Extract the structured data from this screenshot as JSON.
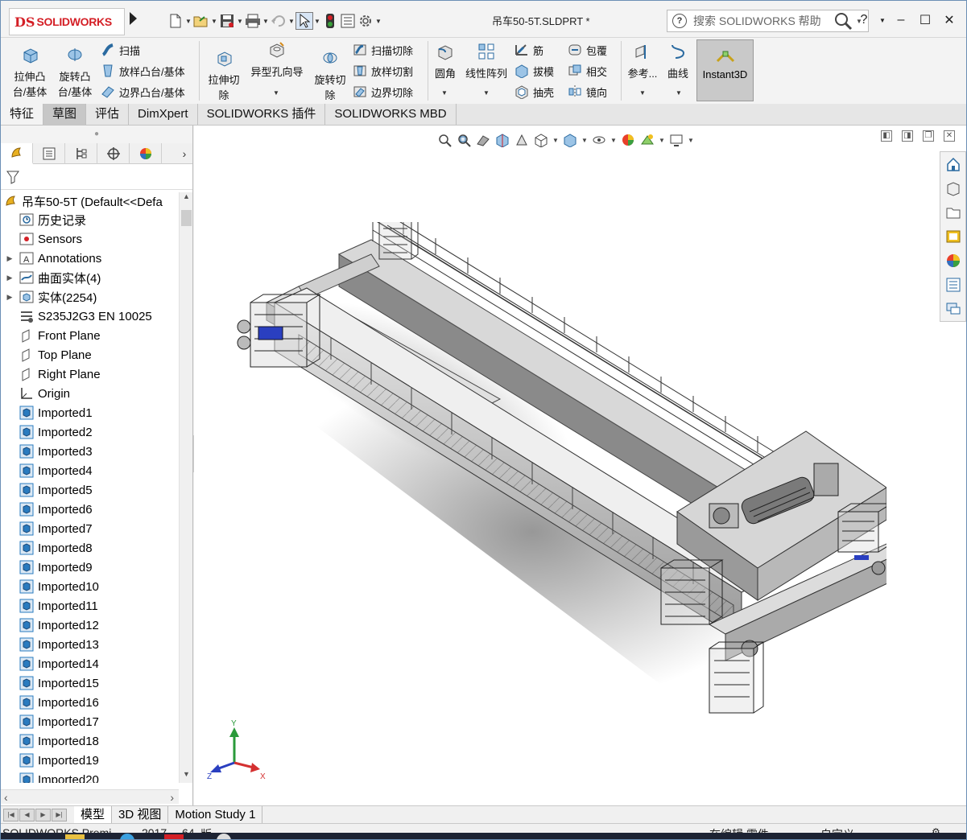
{
  "app": {
    "brand": "SOLIDWORKS",
    "brand_mark": "DS",
    "doc_title": "吊车50-5T.SLDPRT *",
    "search_placeholder": "搜索 SOLIDWORKS 帮助",
    "help": "?",
    "instant3d": "Instant3D"
  },
  "ribbon": {
    "extrude_boss": "拉伸凸台/基体",
    "extrude_boss_l1": "拉伸凸",
    "extrude_boss_l2": "台/基体",
    "revolve_boss_l1": "旋转凸",
    "revolve_boss_l2": "台/基体",
    "sweep": "扫描",
    "loft": "放样凸台/基体",
    "boundary": "边界凸台/基体",
    "extrude_cut_l1": "拉伸切",
    "extrude_cut_l2": "除",
    "hole_wizard": "异型孔向导",
    "revolve_cut_l1": "旋转切",
    "revolve_cut_l2": "除",
    "swept_cut": "扫描切除",
    "lofted_cut": "放样切割",
    "boundary_cut": "边界切除",
    "fillet": "圆角",
    "linear_pattern": "线性阵列",
    "rib": "筋",
    "draft": "拔模",
    "shell": "抽壳",
    "wrap": "包覆",
    "intersect": "相交",
    "mirror": "镜向",
    "ref_geometry": "参考...",
    "curves": "曲线"
  },
  "tabs": [
    "特征",
    "草图",
    "评估",
    "DimXpert",
    "SOLIDWORKS 插件",
    "SOLIDWORKS MBD"
  ],
  "tree": {
    "root": "吊车50-5T  (Default<<Defa",
    "items": [
      {
        "label": "历史记录",
        "icon": "history-icon",
        "expand": false
      },
      {
        "label": "Sensors",
        "icon": "sensors-icon",
        "expand": false
      },
      {
        "label": "Annotations",
        "icon": "annotations-icon",
        "expand": true
      },
      {
        "label": "曲面实体(4)",
        "icon": "surface-bodies-icon",
        "expand": true
      },
      {
        "label": "实体(2254)",
        "icon": "solid-bodies-icon",
        "expand": true
      },
      {
        "label": "S235J2G3 EN 10025",
        "icon": "material-icon",
        "expand": false
      },
      {
        "label": "Front Plane",
        "icon": "plane-icon",
        "expand": false
      },
      {
        "label": "Top Plane",
        "icon": "plane-icon",
        "expand": false
      },
      {
        "label": "Right Plane",
        "icon": "plane-icon",
        "expand": false
      },
      {
        "label": "Origin",
        "icon": "origin-icon",
        "expand": false
      },
      {
        "label": "Imported1",
        "icon": "imported-icon",
        "expand": false
      },
      {
        "label": "Imported2",
        "icon": "imported-icon",
        "expand": false
      },
      {
        "label": "Imported3",
        "icon": "imported-icon",
        "expand": false
      },
      {
        "label": "Imported4",
        "icon": "imported-icon",
        "expand": false
      },
      {
        "label": "Imported5",
        "icon": "imported-icon",
        "expand": false
      },
      {
        "label": "Imported6",
        "icon": "imported-icon",
        "expand": false
      },
      {
        "label": "Imported7",
        "icon": "imported-icon",
        "expand": false
      },
      {
        "label": "Imported8",
        "icon": "imported-icon",
        "expand": false
      },
      {
        "label": "Imported9",
        "icon": "imported-icon",
        "expand": false
      },
      {
        "label": "Imported10",
        "icon": "imported-icon",
        "expand": false
      },
      {
        "label": "Imported11",
        "icon": "imported-icon",
        "expand": false
      },
      {
        "label": "Imported12",
        "icon": "imported-icon",
        "expand": false
      },
      {
        "label": "Imported13",
        "icon": "imported-icon",
        "expand": false
      },
      {
        "label": "Imported14",
        "icon": "imported-icon",
        "expand": false
      },
      {
        "label": "Imported15",
        "icon": "imported-icon",
        "expand": false
      },
      {
        "label": "Imported16",
        "icon": "imported-icon",
        "expand": false
      },
      {
        "label": "Imported17",
        "icon": "imported-icon",
        "expand": false
      },
      {
        "label": "Imported18",
        "icon": "imported-icon",
        "expand": false
      },
      {
        "label": "Imported19",
        "icon": "imported-icon",
        "expand": false
      },
      {
        "label": "Imported20",
        "icon": "imported-icon",
        "expand": false
      }
    ]
  },
  "triad": {
    "x": "X",
    "y": "Y",
    "z": "Z"
  },
  "bottom_tabs": [
    "模型",
    "3D 视图",
    "Motion Study 1"
  ],
  "status": {
    "product": "SOLIDWORKS Premi",
    "year": "2017",
    "bits": "64",
    "edition": "版",
    "editing": "在编辑 零件",
    "units": "自定义"
  },
  "colors": {
    "brand_red": "#d41f26",
    "instant3d_bg": "#c9c9c9",
    "tab_active": "#c7c7c7",
    "tree_icon_blue": "#2a7bbf"
  }
}
